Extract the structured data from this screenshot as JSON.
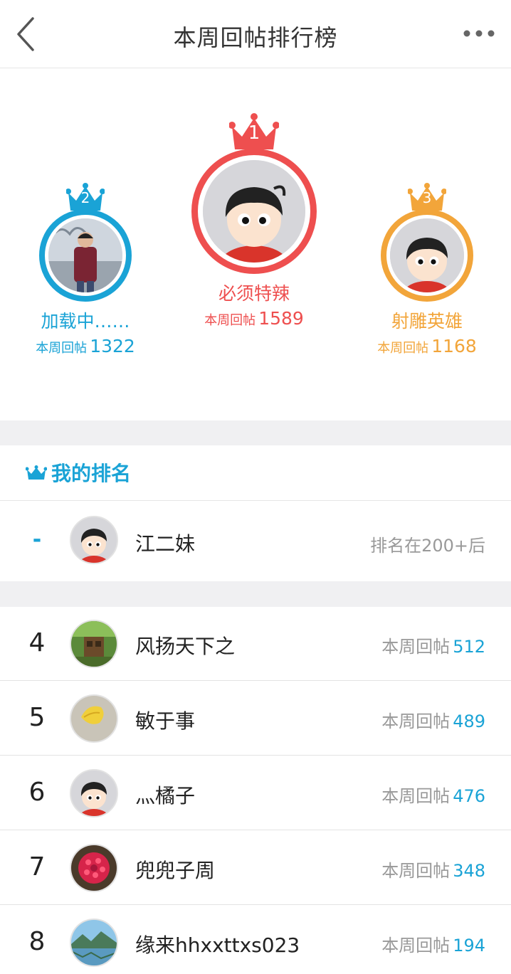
{
  "header": {
    "title": "本周回帖排行榜",
    "back_icon": "chevron-left-icon",
    "more_icon": "more-dots-icon"
  },
  "podium": [
    {
      "rank": "1",
      "name": "必须特辣",
      "count_label": "本周回帖",
      "count": "1589",
      "color": "#ee4f4f"
    },
    {
      "rank": "2",
      "name": "加载中……",
      "count_label": "本周回帖",
      "count": "1322",
      "color": "#1aa3d6"
    },
    {
      "rank": "3",
      "name": "射雕英雄",
      "count_label": "本周回帖",
      "count": "1168",
      "color": "#f2a53a"
    }
  ],
  "my_rank": {
    "title": "我的排名",
    "rank": "-",
    "name": "江二妹",
    "status": "排名在200+后"
  },
  "list_label": "本周回帖",
  "list": [
    {
      "rank": "4",
      "name": "风扬天下之",
      "count": "512"
    },
    {
      "rank": "5",
      "name": "敏于事",
      "count": "489"
    },
    {
      "rank": "6",
      "name": "灬橘子",
      "count": "476"
    },
    {
      "rank": "7",
      "name": "兜兜子周",
      "count": "348"
    },
    {
      "rank": "8",
      "name": "缘来hhxxttxs023",
      "count": "194"
    }
  ],
  "colors": {
    "accent_blue": "#1aa3d6",
    "gold": "#f2a53a",
    "red": "#ee4f4f",
    "band": "#f0f0f2"
  }
}
